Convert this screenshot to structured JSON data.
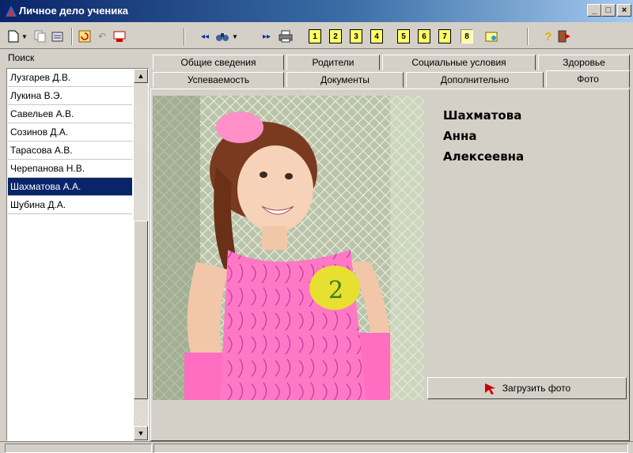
{
  "window": {
    "title": "Личное дело ученика",
    "buttons": {
      "minimize": "_",
      "maximize": "□",
      "close": "×"
    }
  },
  "toolbar": {
    "icons": [
      "new-doc-icon",
      "dropdown-icon",
      "copy-icon",
      "edit-icon",
      "refresh-icon",
      "undo-icon",
      "delete-icon",
      "prev-icon",
      "binoculars-icon",
      "next-icon",
      "print-icon",
      "help-icon",
      "exit-icon"
    ],
    "numbered": [
      "1",
      "2",
      "3",
      "4",
      "5",
      "6",
      "7",
      "8"
    ],
    "active_number": "8"
  },
  "search": {
    "label": "Поиск"
  },
  "students": [
    "Лузгарев Д.В.",
    "Лукина В.Э.",
    "Савельев А.В.",
    "Созинов Д.А.",
    "Тарасова А.В.",
    "Черепанова Н.В.",
    "Шахматова А.А.",
    "Шубина Д.А."
  ],
  "selected_student_index": 6,
  "tabs": {
    "row1": [
      "Общие сведения",
      "Родители",
      "Социальные условия",
      "Здоровье"
    ],
    "row2": [
      "Успеваемость",
      "Документы",
      "Дополнительно",
      "Фото"
    ],
    "active": "Фото"
  },
  "person": {
    "surname": "Шахматова",
    "name": "Анна",
    "patronymic": "Алексеевна"
  },
  "upload_button": {
    "label": "Загрузить фото"
  },
  "photo_badge": "2",
  "colors": {
    "selection": "#0a246a",
    "window": "#d4d0c8",
    "badge": "#e8e030",
    "dress": "#ff7fc6"
  }
}
